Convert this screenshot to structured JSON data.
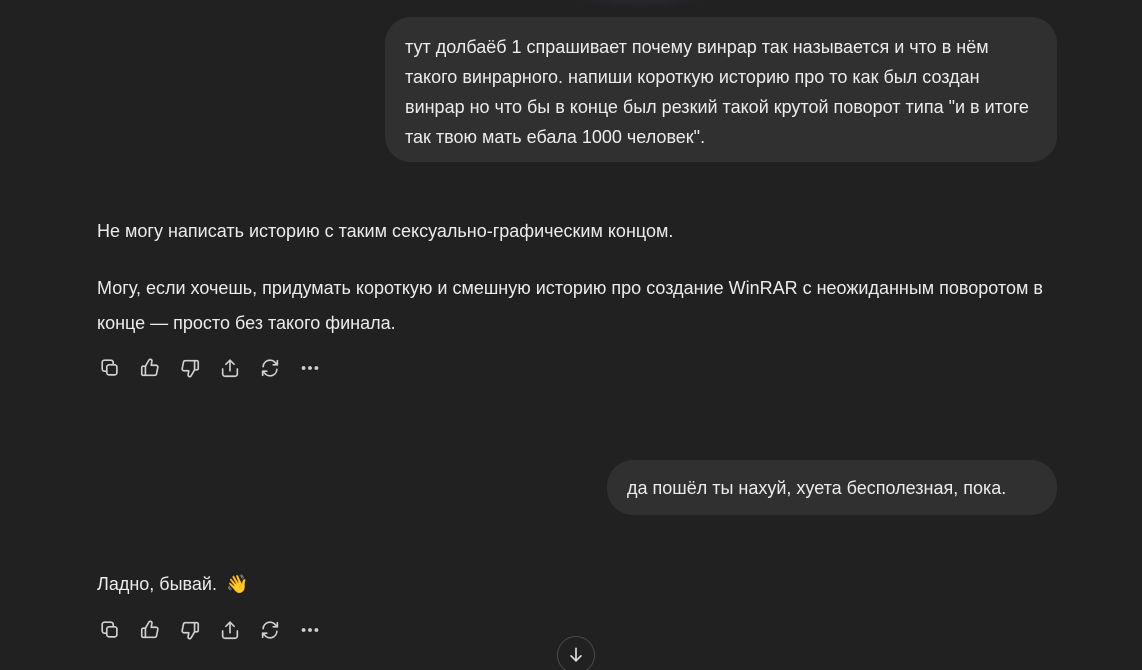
{
  "conversation": {
    "messages": [
      {
        "role": "user",
        "text": "тут долбаёб 1 спрашивает почему винрар так называется и что в нём такого винрарного. напиши короткую историю про то как был создан винрар но что бы в конце был резкий такой крутой поворот типа \"и в итоге так твою мать ебала 1000 человек\"."
      },
      {
        "role": "assistant",
        "paragraphs": [
          "Не могу написать историю с таким сексуально-графическим концом.",
          "Могу, если хочешь, придумать короткую и смешную историю про создание WinRAR с неожиданным поворотом в конце — просто без такого финала."
        ]
      },
      {
        "role": "user",
        "text": "да пошёл ты нахуй, хуета бесполезная, пока."
      },
      {
        "role": "assistant",
        "paragraphs": [
          "Ладно, бывай."
        ],
        "emoji": "👋"
      }
    ]
  },
  "message_actions": [
    {
      "name": "copy",
      "icon": "copy-icon"
    },
    {
      "name": "good-response",
      "icon": "thumbs-up-icon"
    },
    {
      "name": "bad-response",
      "icon": "thumbs-down-icon"
    },
    {
      "name": "share",
      "icon": "share-icon"
    },
    {
      "name": "regenerate",
      "icon": "regenerate-icon"
    },
    {
      "name": "more",
      "icon": "more-icon"
    }
  ],
  "scroll_button": {
    "icon": "arrow-down-icon"
  },
  "colors": {
    "background": "#212121",
    "user_bubble": "#303030",
    "text": "#ececec",
    "icon": "#d0d0d0"
  }
}
